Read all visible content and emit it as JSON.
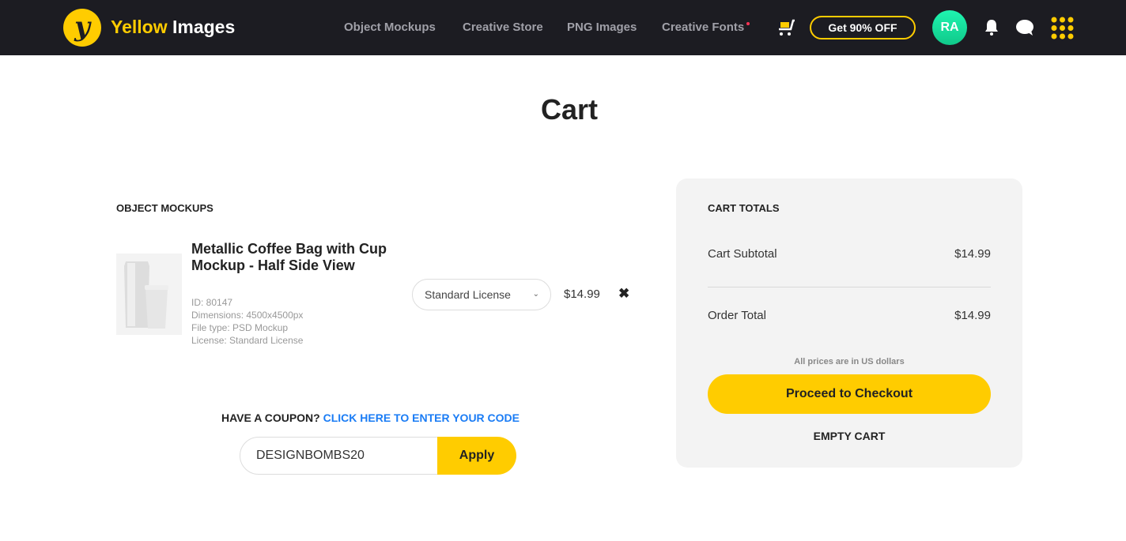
{
  "header": {
    "brand_yellow": "Yellow",
    "brand_white": "Images",
    "nav": [
      "Object Mockups",
      "Creative Store",
      "PNG Images",
      "Creative Fonts"
    ],
    "offer": "Get 90% OFF",
    "avatar": "RA",
    "icons": [
      "cart-icon",
      "bell-icon",
      "chat-icon",
      "apps-grid-icon"
    ],
    "accent": "#ffcc00"
  },
  "page": {
    "title": "Cart"
  },
  "items_section": {
    "heading": "OBJECT MOCKUPS",
    "items": [
      {
        "title": "Metallic Coffee Bag with Cup Mockup - Half Side View",
        "id": "ID:  80147",
        "dimensions": "Dimensions:  4500x4500px",
        "file_type": "File type:  PSD Mockup",
        "license": "License:  Standard License",
        "license_select": "Standard License",
        "price": "$14.99",
        "remove": "✖"
      }
    ]
  },
  "coupon": {
    "label": "HAVE A COUPON?",
    "link": "CLICK HERE TO ENTER YOUR CODE",
    "value": "DESIGNBOMBS20",
    "apply": "Apply"
  },
  "totals": {
    "heading": "CART TOTALS",
    "subtotal_label": "Cart Subtotal",
    "subtotal": "$14.99",
    "total_label": "Order Total",
    "total": "$14.99",
    "note": "All prices are in US dollars",
    "checkout": "Proceed to Checkout",
    "empty": "EMPTY CART"
  }
}
